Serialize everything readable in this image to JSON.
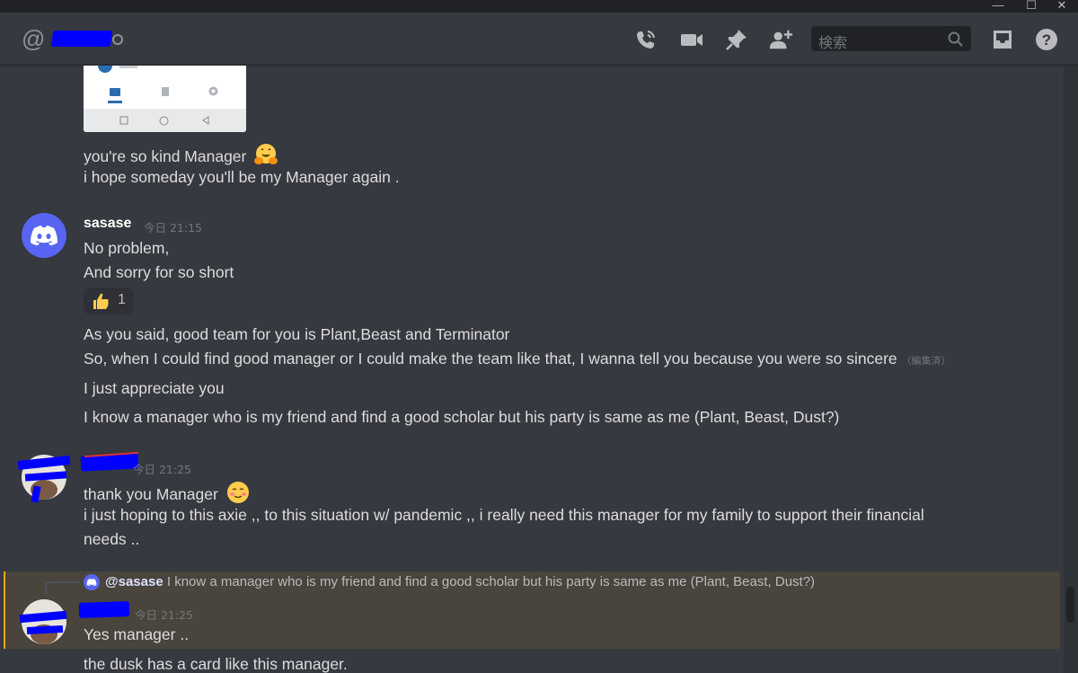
{
  "window": {
    "minimize": "—",
    "maximize": "☐",
    "close": "✕"
  },
  "header": {
    "at_symbol": "@",
    "search_placeholder": "検索",
    "icons": [
      "voice-call-icon",
      "video-call-icon",
      "pin-icon",
      "add-member-icon",
      "search-icon",
      "inbox-icon",
      "help-icon"
    ]
  },
  "messages": [
    {
      "lines": [
        "you're so kind Manager",
        " i hope someday you'll be my Manager again ."
      ],
      "emoji": "hugging-face"
    },
    {
      "author": "sasase",
      "timestamp": "今日 21:15",
      "lines": [
        "No problem,",
        "And sorry for so short"
      ],
      "reaction": {
        "emoji": "thumbs-up",
        "count": "1"
      },
      "lines2": [
        "As you said, good team for you is Plant,Beast and Terminator",
        "So, when I could find good manager or I could make the team like that, I wanna tell you because you were so sincere",
        "I just appreciate you",
        "I know a manager who is my friend and find a good scholar but his party is same as me (Plant, Beast, Dust?)"
      ],
      "edited": "（編集済）"
    },
    {
      "timestamp": "今日 21:25",
      "lines": [
        "thank you Manager",
        "i just hoping to this axie ,, to this situation w/ pandemic ,,  i really need this manager for my family to support their financial",
        "needs .."
      ],
      "emoji": "smiling-face"
    },
    {
      "reply": {
        "mention": "@sasase",
        "text": "I know a manager who is my friend and find a good scholar but his party is same as me (Plant, Beast, Dust?)"
      },
      "timestamp": "今日 21:25",
      "lines": [
        "Yes manager ..",
        "the dusk has a card like this manager."
      ]
    }
  ],
  "colors": {
    "background": "#36393f",
    "accent": "#5865f2",
    "highlight": "#49443c",
    "mention_bar": "#faa81a"
  }
}
